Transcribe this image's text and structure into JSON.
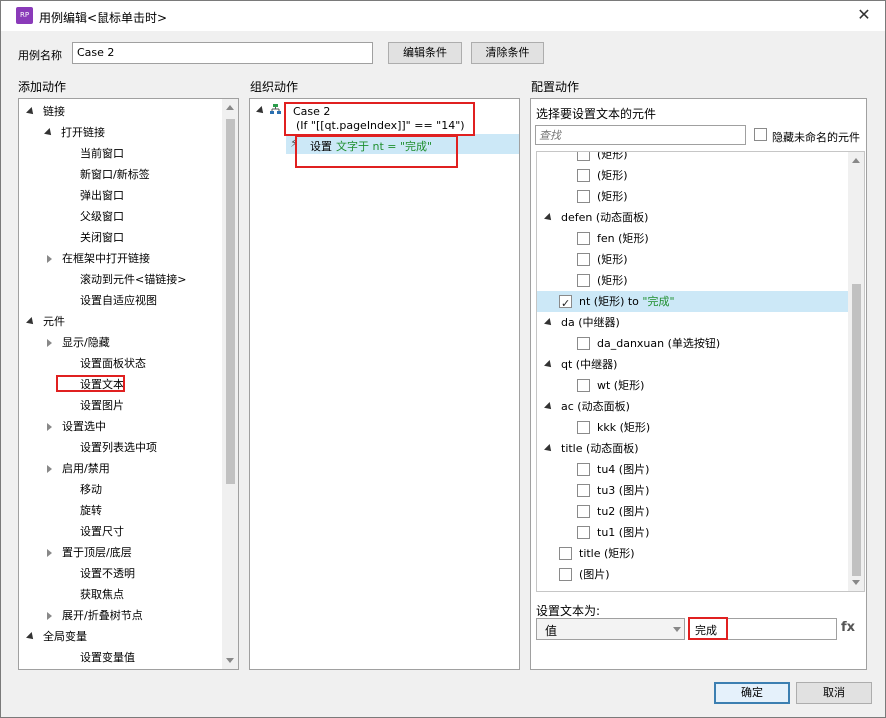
{
  "window": {
    "title": "用例编辑<鼠标单击时>"
  },
  "case_name": {
    "label": "用例名称",
    "value": "Case 2",
    "edit_btn": "编辑条件",
    "clear_btn": "清除条件"
  },
  "add_actions": {
    "title": "添加动作",
    "items": [
      {
        "label": "链接"
      },
      {
        "label": "打开链接"
      },
      {
        "label": "当前窗口"
      },
      {
        "label": "新窗口/新标签"
      },
      {
        "label": "弹出窗口"
      },
      {
        "label": "父级窗口"
      },
      {
        "label": "关闭窗口"
      },
      {
        "label": "在框架中打开链接"
      },
      {
        "label": "滚动到元件<锚链接>"
      },
      {
        "label": "设置自适应视图"
      },
      {
        "label": "元件"
      },
      {
        "label": "显示/隐藏"
      },
      {
        "label": "设置面板状态"
      },
      {
        "label": "设置文本"
      },
      {
        "label": "设置图片"
      },
      {
        "label": "设置选中"
      },
      {
        "label": "设置列表选中项"
      },
      {
        "label": "启用/禁用"
      },
      {
        "label": "移动"
      },
      {
        "label": "旋转"
      },
      {
        "label": "设置尺寸"
      },
      {
        "label": "置于顶层/底层"
      },
      {
        "label": "设置不透明"
      },
      {
        "label": "获取焦点"
      },
      {
        "label": "展开/折叠树节点"
      },
      {
        "label": "全局变量"
      },
      {
        "label": "设置变量值"
      }
    ]
  },
  "organize": {
    "title": "组织动作",
    "case_label": "Case 2",
    "condition": "(If \"[[qt.pageIndex]]\" == \"14\")",
    "action_prefix": "设置",
    "action_text": "文字于 nt = \"完成\""
  },
  "configure": {
    "title": "配置动作",
    "subtitle": "选择要设置文本的元件",
    "search_placeholder": "查找",
    "hide_unnamed": "隐藏未命名的元件",
    "tree": [
      {
        "label": "(矩形)"
      },
      {
        "label": "(矩形)"
      },
      {
        "label": "(矩形)"
      },
      {
        "label": "defen (动态面板)"
      },
      {
        "label": "fen (矩形)"
      },
      {
        "label": "(矩形)"
      },
      {
        "label": "(矩形)"
      },
      {
        "label": "nt (矩形) to ",
        "suffix": "\"完成\""
      },
      {
        "label": "da (中继器)"
      },
      {
        "label": "da_danxuan (单选按钮)"
      },
      {
        "label": "qt (中继器)"
      },
      {
        "label": "wt (矩形)"
      },
      {
        "label": "ac (动态面板)"
      },
      {
        "label": "kkk (矩形)"
      },
      {
        "label": "title (动态面板)"
      },
      {
        "label": "tu4 (图片)"
      },
      {
        "label": "tu3 (图片)"
      },
      {
        "label": "tu2 (图片)"
      },
      {
        "label": "tu1 (图片)"
      },
      {
        "label": "title (矩形)"
      },
      {
        "label": "(图片)"
      }
    ],
    "set_text_label": "设置文本为:",
    "value_type": "值",
    "value": "完成",
    "fx": "fx"
  },
  "footer": {
    "ok": "确定",
    "cancel": "取消"
  }
}
